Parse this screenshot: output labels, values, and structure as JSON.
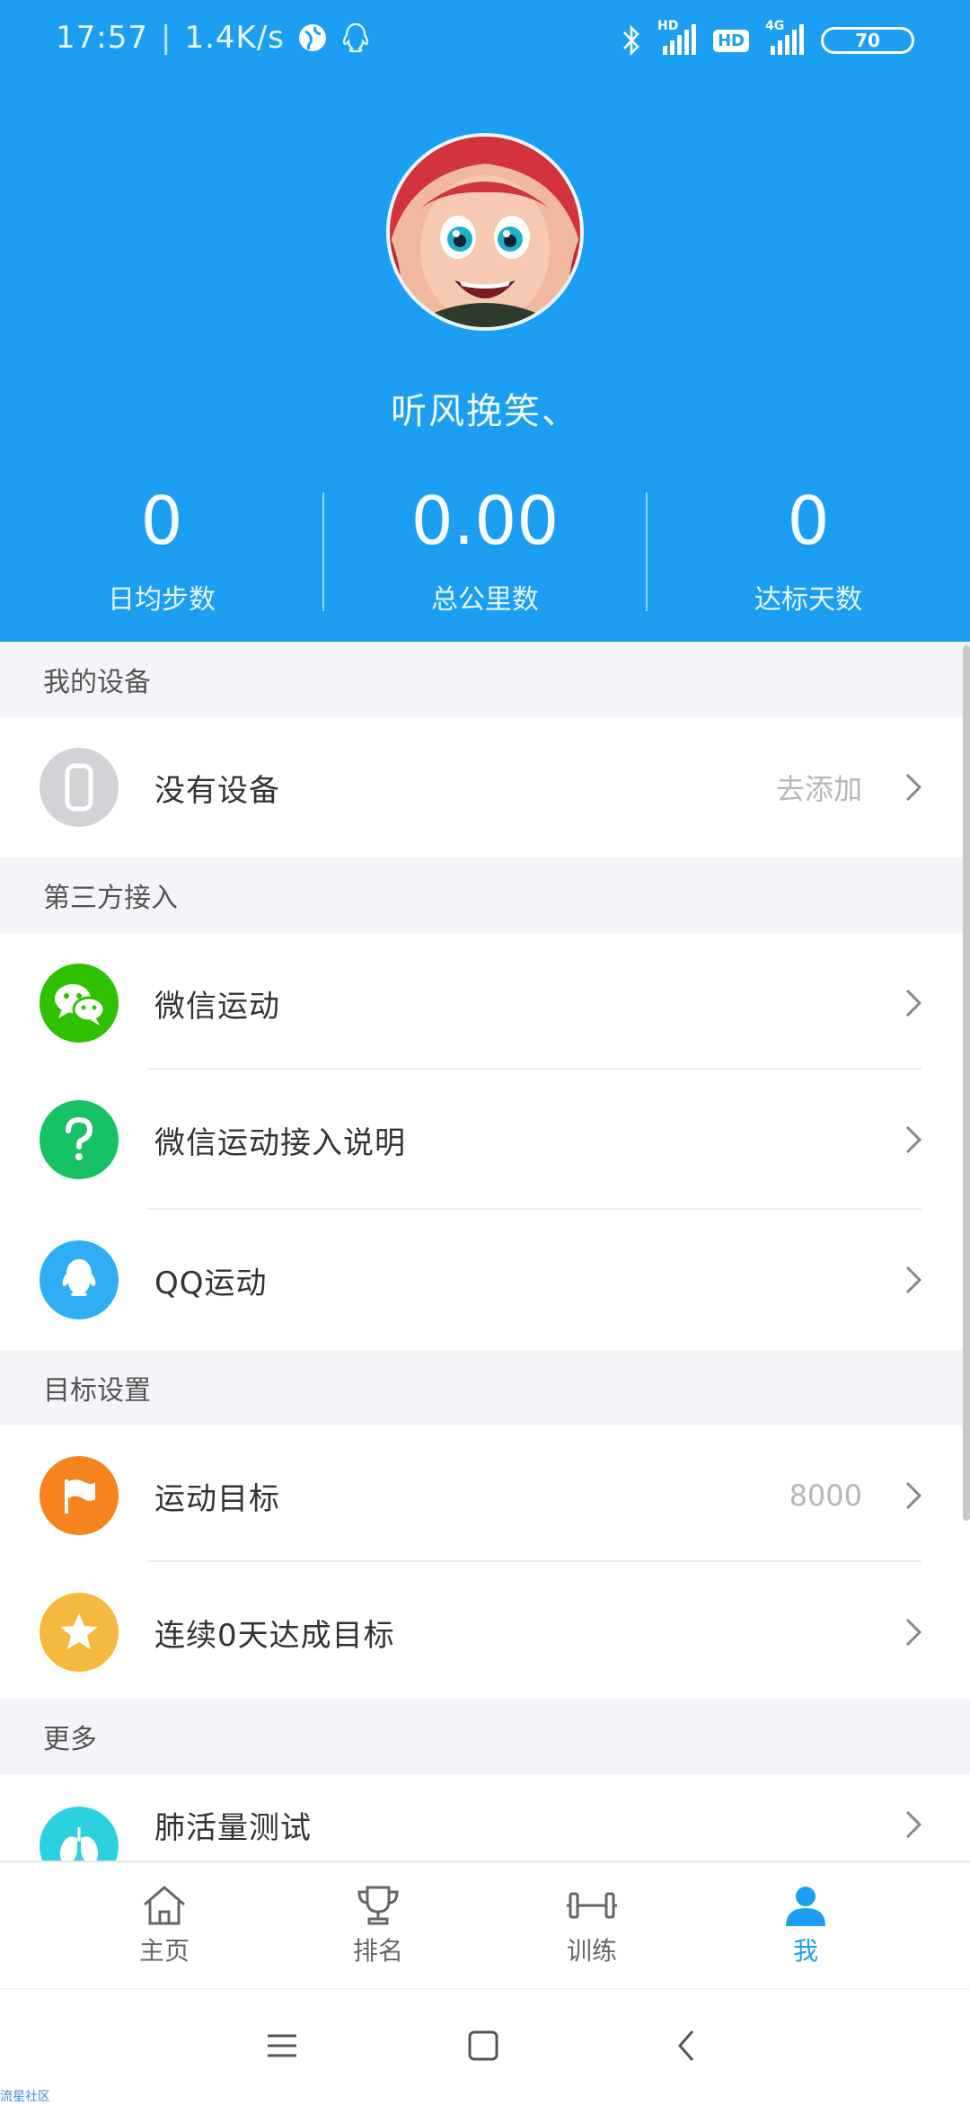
{
  "status_bar": {
    "time": "17:57",
    "speed": "1.4K/s",
    "signal_1_label": "HD",
    "hd_badge": "HD",
    "signal_2_label": "4G",
    "battery": "70"
  },
  "profile": {
    "username": "听风挽笑、",
    "stats": [
      {
        "value": "0",
        "label": "日均步数"
      },
      {
        "value": "0.00",
        "label": "总公里数"
      },
      {
        "value": "0",
        "label": "达标天数"
      }
    ]
  },
  "sections": {
    "my_devices": {
      "title": "我的设备",
      "rows": [
        {
          "label": "没有设备",
          "value": "去添加",
          "icon": "watch-icon",
          "color": "#d1d3d6"
        }
      ]
    },
    "third_party": {
      "title": "第三方接入",
      "rows": [
        {
          "label": "微信运动",
          "icon": "wechat-icon",
          "color": "#2dc100"
        },
        {
          "label": "微信运动接入说明",
          "icon": "question-icon",
          "color": "#16c264"
        },
        {
          "label": "QQ运动",
          "icon": "qq-penguin-icon",
          "color": "#30aef5"
        }
      ]
    },
    "goal_settings": {
      "title": "目标设置",
      "rows": [
        {
          "label": "运动目标",
          "value": "8000",
          "icon": "flag-icon",
          "color": "#f5841f"
        },
        {
          "label": "连续0天达成目标",
          "icon": "star-icon",
          "color": "#f5b93d"
        }
      ]
    },
    "more": {
      "title": "更多",
      "rows": [
        {
          "label": "肺活量测试",
          "icon": "lungs-icon",
          "color": "#2bd1de"
        }
      ]
    }
  },
  "tabbar": {
    "tabs": [
      {
        "label": "主页",
        "icon": "home-icon"
      },
      {
        "label": "排名",
        "icon": "trophy-icon"
      },
      {
        "label": "训练",
        "icon": "dumbbell-icon"
      },
      {
        "label": "我",
        "icon": "person-icon",
        "active": true
      }
    ]
  },
  "watermark": "流星社区",
  "colors": {
    "primary": "#1c9ff2",
    "section_bg": "#f3f5f9"
  }
}
